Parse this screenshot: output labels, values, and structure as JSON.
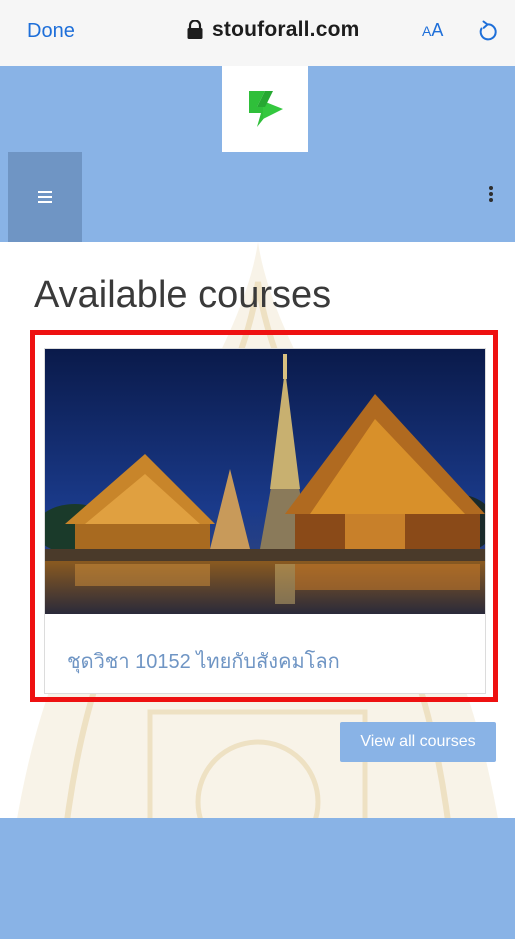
{
  "browser": {
    "done_label": "Done",
    "url": "stouforall.com",
    "text_size_large": "A",
    "text_size_small": "A"
  },
  "page": {
    "title": "Available courses"
  },
  "course": {
    "title": "ชุดวิชา 10152 ไทยกับสังคมโลก"
  },
  "actions": {
    "view_all_label": "View all courses"
  },
  "colors": {
    "accent": "#89b3e6",
    "accent_dark": "#6f95c4",
    "link": "#1e6fd9",
    "highlight": "#ee1111"
  },
  "icons": {
    "lock": "lock-icon",
    "reload": "reload-icon",
    "menu": "hamburger-menu-icon",
    "more": "kebab-menu-icon",
    "logo": "site-logo"
  }
}
